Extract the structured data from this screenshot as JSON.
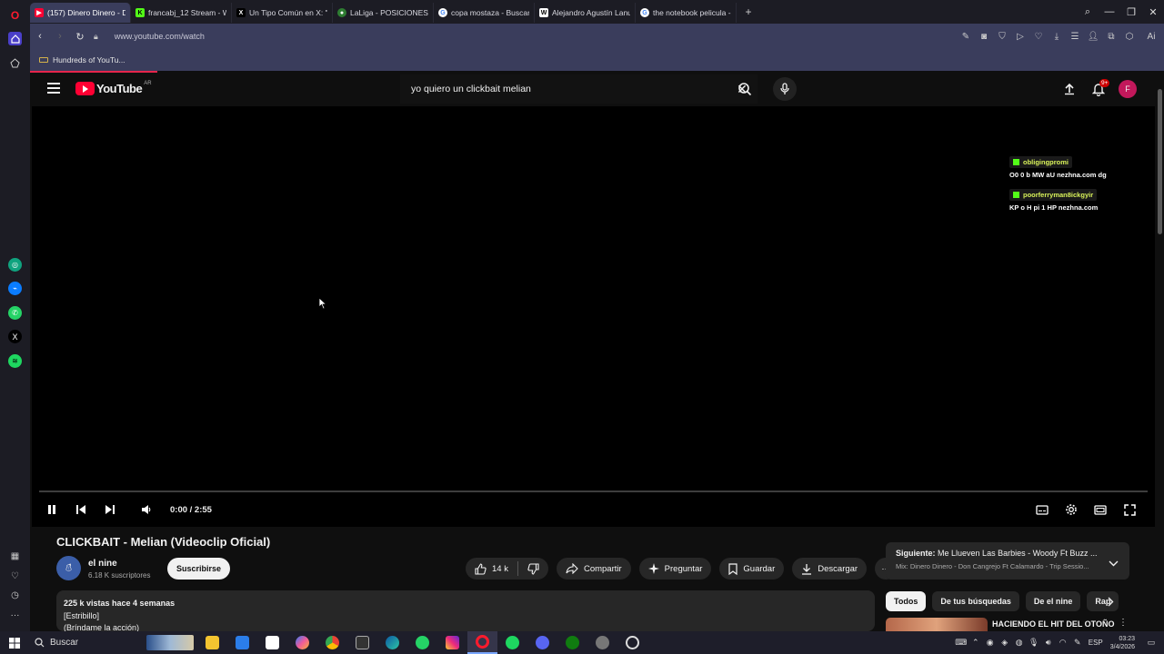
{
  "browser": {
    "tabs": [
      {
        "title": "(157) Dinero Dinero - Don",
        "favicon": "youtube-icon",
        "color": "#ff0033",
        "active": true
      },
      {
        "title": "francabj_12 Stream - Watc",
        "favicon": "kick-icon",
        "color": "#53fc18",
        "active": false
      },
      {
        "title": "Un Tipo Común en X: \"@D",
        "favicon": "x-icon",
        "color": "#000000",
        "active": false
      },
      {
        "title": "LaLiga - POSICIONES, RES",
        "favicon": "laliga-icon",
        "color": "#2e7d32",
        "active": false
      },
      {
        "title": "copa mostaza - Buscar co",
        "favicon": "google-icon",
        "color": "#4285f4",
        "active": false
      },
      {
        "title": "Alejandro Agustín Lanuss",
        "favicon": "wikipedia-icon",
        "color": "#ffffff",
        "active": false
      },
      {
        "title": "the notebook pelicula - B",
        "favicon": "google-icon",
        "color": "#4285f4",
        "active": false
      }
    ],
    "url": "www.youtube.com/watch",
    "bookmark": "Hundreds of YouTu...",
    "ai_label": "Ai"
  },
  "youtube": {
    "logo_text": "YouTube",
    "country_code": "AR",
    "search_query": "yo quiero un clickbait melian",
    "notification_badge": "9+",
    "avatar_letter": "F"
  },
  "player": {
    "time": "0:00 / 2:55",
    "progress": 0,
    "chat": [
      {
        "user": "obligingpromi",
        "message": "O0 0 b MW aU nezhna.com dg"
      },
      {
        "user": "poorferryman8ickgyir",
        "message": "KP o H pi 1 HP nezhna.com"
      }
    ]
  },
  "video": {
    "title": "CLICKBAIT - Melian (Videoclip Oficial)",
    "channel": "el nine",
    "subscribers": "6.18 K suscriptores",
    "subscribe_label": "Suscribirse",
    "likes": "14 k",
    "share_label": "Compartir",
    "ask_label": "Preguntar",
    "save_label": "Guardar",
    "download_label": "Descargar",
    "description": {
      "stats": "225 k vistas  hace 4 semanas",
      "line1": "[Estribillo]",
      "line2": "(Bríndame la acción)"
    }
  },
  "sidebar_right": {
    "next_prefix": "Siguiente:",
    "next_title": "Me Llueven Las Barbies - Woody Ft Buzz ...",
    "next_sub": "Mix: Dinero Dinero - Don Cangrejo Ft Calamardo - Trip Sessio...",
    "chips": [
      "Todos",
      "De tus búsquedas",
      "De el nine",
      "Rap"
    ],
    "rec_title": "HACIENDO EL HIT DEL OTOÑO"
  },
  "taskbar": {
    "search_label": "Buscar",
    "lang": "ESP",
    "time": "03:23",
    "date": "3/4/2026"
  }
}
